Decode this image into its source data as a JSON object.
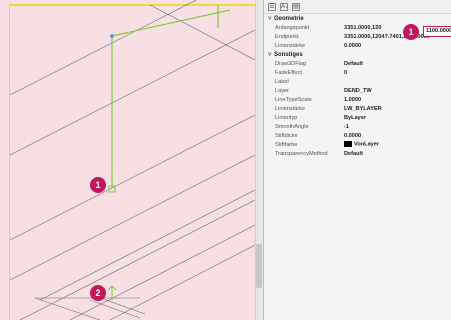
{
  "toolbar": {
    "icons": [
      "sort-categorized-icon",
      "sort-alphabetical-icon",
      "property-pages-icon"
    ],
    "sort_label": "A↓"
  },
  "groups": [
    {
      "label": "Geometrie",
      "rows": [
        {
          "name": "Anfangspunkt",
          "value": "3351.0000,120"
        },
        {
          "name": "Endpunkt",
          "value": "3351.0000,1204?.7401,2700.0000"
        },
        {
          "name": "Linienstärke",
          "value": "0.0000"
        }
      ]
    },
    {
      "label": "Sonstiges",
      "rows": [
        {
          "name": "Draw3DFlag",
          "value": "Default"
        },
        {
          "name": "FadeEffect",
          "value": "0"
        },
        {
          "name": "Label",
          "value": ""
        },
        {
          "name": "Layer",
          "value": "DEND_TW"
        },
        {
          "name": "LineTypeScale",
          "value": "1.0000"
        },
        {
          "name": "Linienstärke",
          "value": "LW_BYLAYER"
        },
        {
          "name": "Linientyp",
          "value": "ByLayer"
        },
        {
          "name": "SmoothAngle",
          "value": "-1"
        },
        {
          "name": "Stiftdicke",
          "value": "0.0000"
        },
        {
          "name": "Stiftfarbe",
          "value": "VonLayer"
        },
        {
          "name": "TransparencyMethod",
          "value": "Default"
        }
      ]
    }
  ],
  "highlighted_value": "1100.0000",
  "callouts": {
    "canvas_1": "1",
    "canvas_2": "2",
    "panel_1": "1"
  },
  "colors": {
    "callout": "#c2185b",
    "green_line": "#7ccc3a",
    "yellow_border": "#e8dc3a",
    "canvas_bg": "#f8dfe4"
  }
}
